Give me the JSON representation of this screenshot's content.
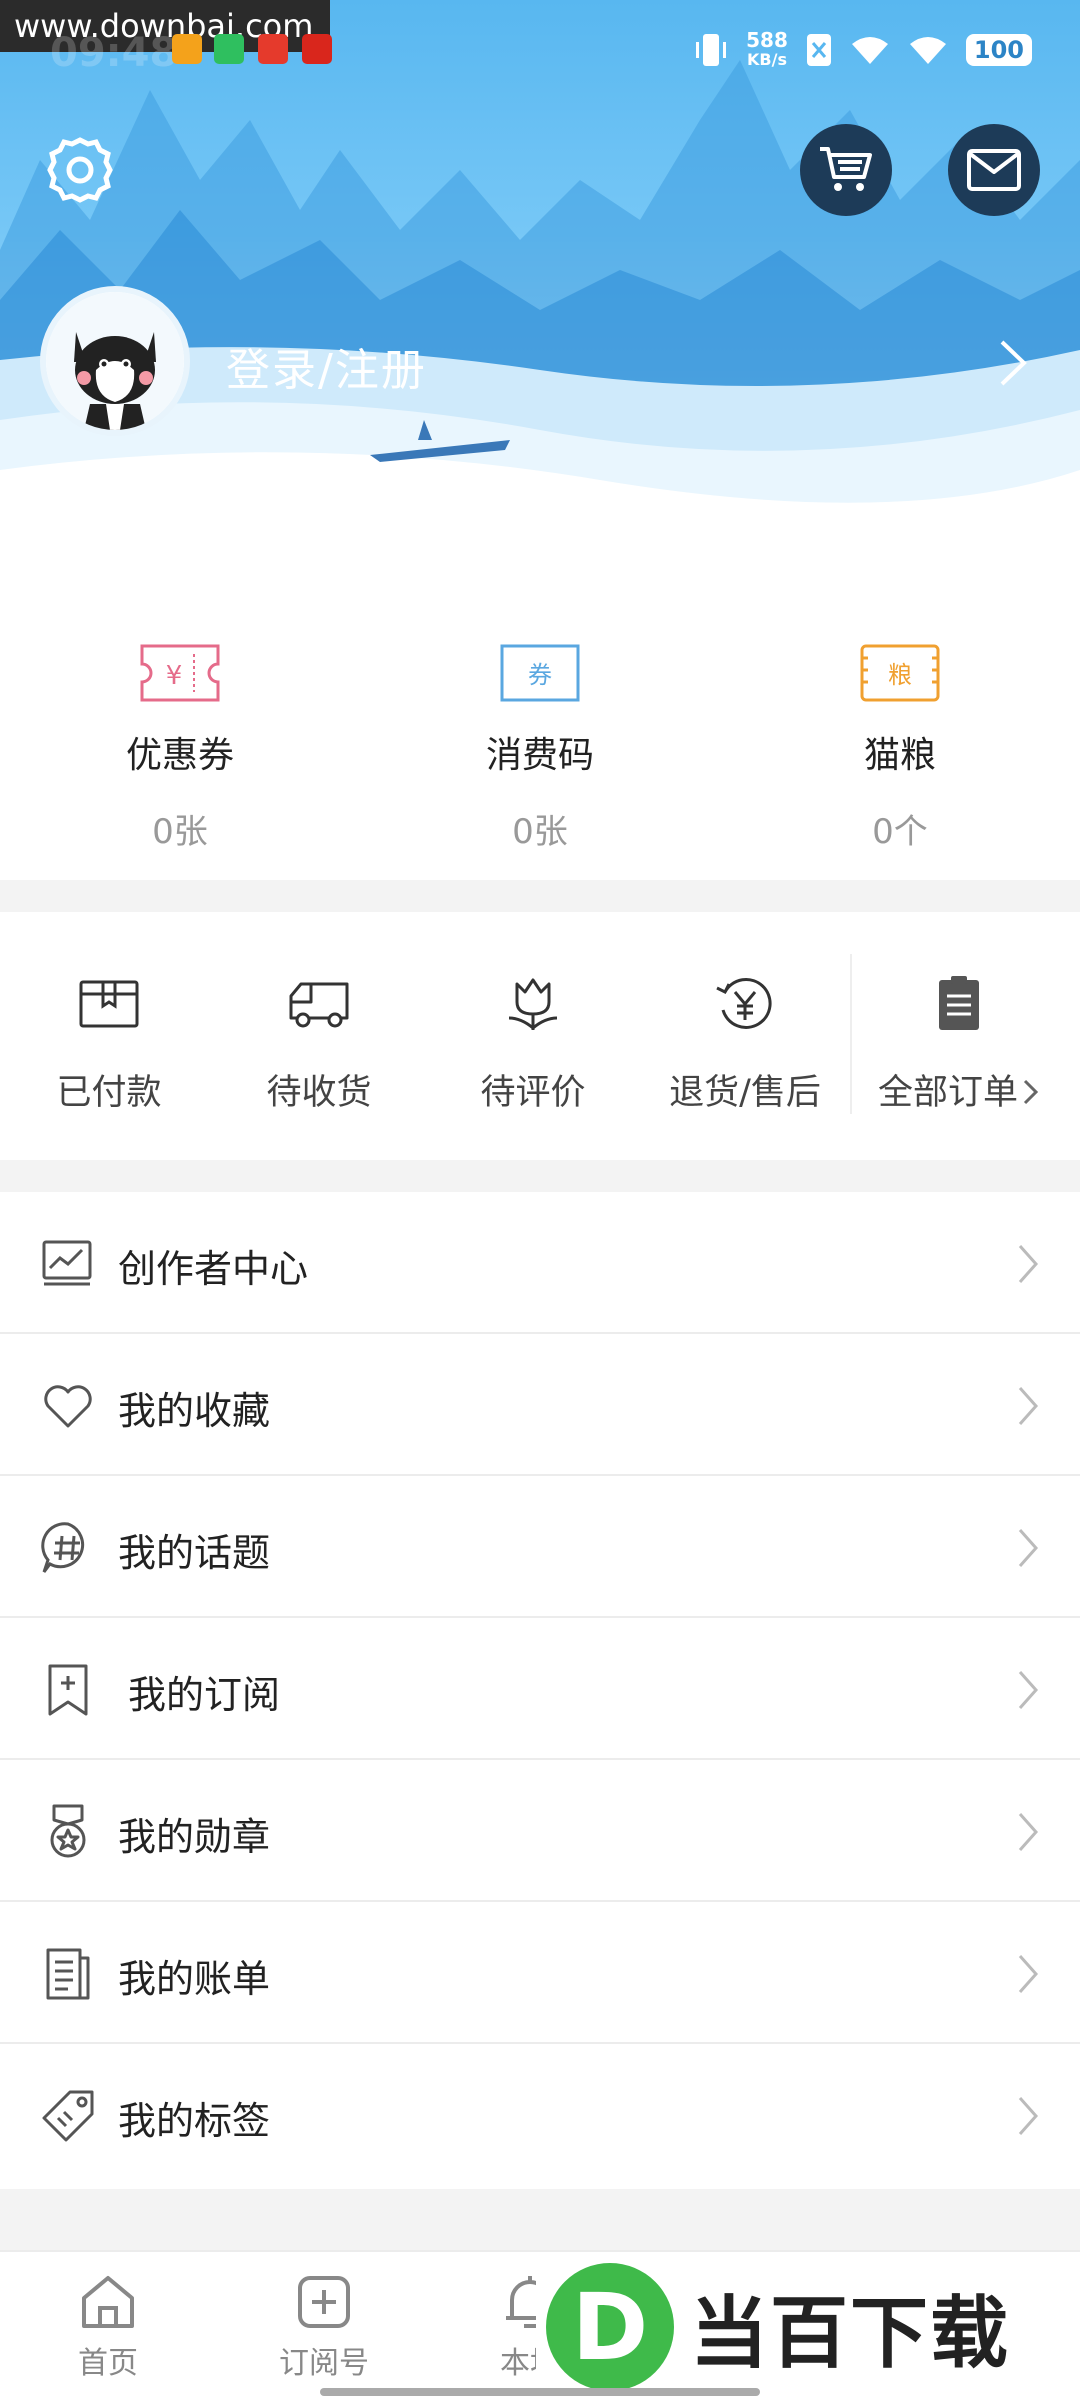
{
  "watermark": "www.downbai.com",
  "status_bar": {
    "time": "09:48",
    "net_speed_value": "588",
    "net_speed_unit": "KB/s",
    "battery": "100"
  },
  "header": {
    "login_text": "登录/注册",
    "icons": [
      "gear-icon",
      "cart-icon",
      "mail-icon",
      "chevron-right-icon"
    ]
  },
  "coupons": [
    {
      "label": "优惠券",
      "count": "0张",
      "glyph": "¥",
      "color": "#e56b8a"
    },
    {
      "label": "消费码",
      "count": "0张",
      "glyph": "券",
      "color": "#5aa7e0"
    },
    {
      "label": "猫粮",
      "count": "0个",
      "glyph": "粮",
      "color": "#f0a030"
    }
  ],
  "orders": [
    {
      "label": "已付款",
      "icon": "paid-box-icon"
    },
    {
      "label": "待收货",
      "icon": "truck-icon"
    },
    {
      "label": "待评价",
      "icon": "tulip-icon"
    },
    {
      "label": "退货/售后",
      "icon": "refund-icon"
    },
    {
      "label": "全部订单",
      "icon": "clipboard-icon"
    }
  ],
  "menu": [
    {
      "label": "创作者中心",
      "icon": "chart-board-icon"
    },
    {
      "label": "我的收藏",
      "icon": "heart-icon"
    },
    {
      "label": "我的话题",
      "icon": "hashtag-bubble-icon"
    },
    {
      "label": "我的订阅",
      "icon": "bookmark-plus-icon"
    },
    {
      "label": "我的勋章",
      "icon": "medal-icon"
    },
    {
      "label": "我的账单",
      "icon": "bill-icon"
    },
    {
      "label": "我的标签",
      "icon": "tag-icon"
    }
  ],
  "bottom_nav": [
    {
      "label": "首页",
      "icon": "home-icon"
    },
    {
      "label": "订阅号",
      "icon": "plus-square-icon"
    },
    {
      "label": "本地",
      "icon": "bell-icon"
    }
  ],
  "brand": {
    "logo_letter": "D",
    "text": "当百下载"
  },
  "colors": {
    "sky": "#58b7f0",
    "dark_button": "#1d3b58",
    "text_primary": "#222222",
    "text_secondary": "#999999",
    "brand_green": "#3fba4a"
  }
}
